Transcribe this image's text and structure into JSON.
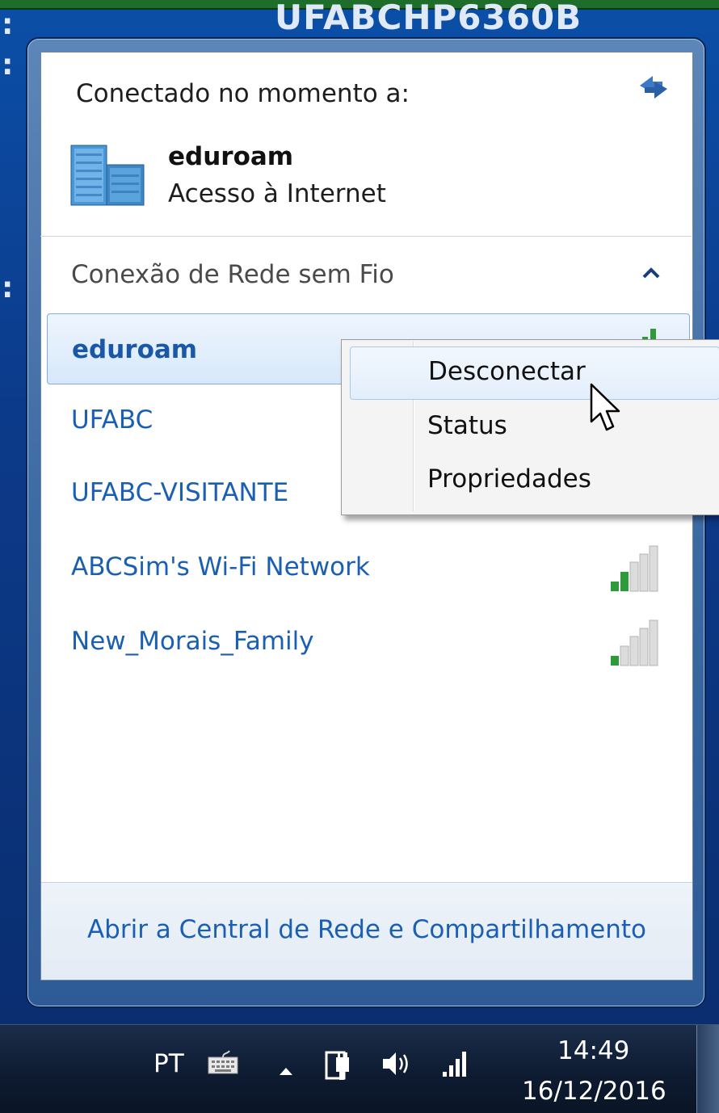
{
  "background": {
    "window_title": "UFABCHP6360B"
  },
  "flyout": {
    "connected_label": "Conectado no momento a:",
    "current_network": {
      "name": "eduroam",
      "status": "Acesso à Internet"
    },
    "section_label": "Conexão de Rede sem Fio",
    "networks": [
      {
        "name": "eduroam",
        "selected": true
      },
      {
        "name": "UFABC"
      },
      {
        "name": "UFABC-VISITANTE"
      },
      {
        "name": "ABCSim's Wi-Fi Network",
        "signal_bars": 2
      },
      {
        "name": "New_Morais_Family",
        "signal_bars": 1
      }
    ],
    "footer_link": "Abrir a Central de Rede e Compartilhamento"
  },
  "context_menu": {
    "items": [
      {
        "label": "Desconectar",
        "hovered": true
      },
      {
        "label": "Status"
      },
      {
        "label": "Propriedades"
      }
    ]
  },
  "taskbar": {
    "language": "PT",
    "time": "14:49",
    "date": "16/12/2016"
  },
  "colors": {
    "link_blue": "#1a5fb4",
    "signal_green": "#2e9a3a",
    "desktop_blue": "#0b4fa8"
  }
}
